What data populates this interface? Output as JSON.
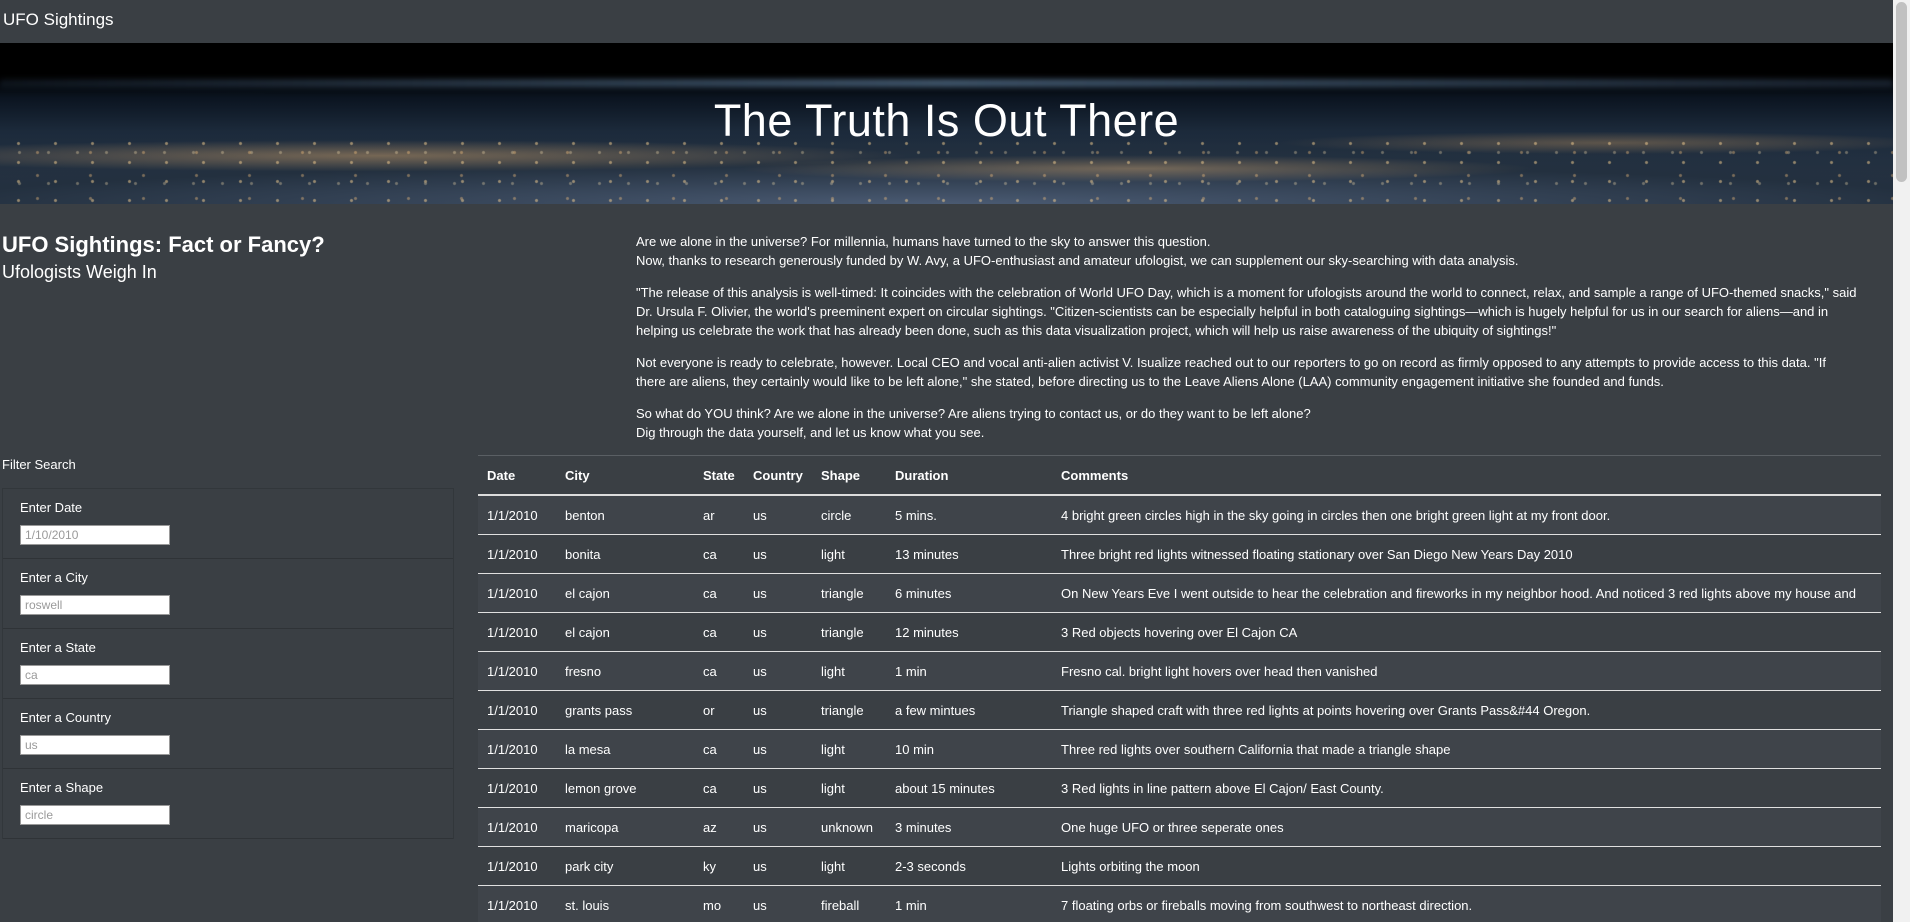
{
  "navbar": {
    "brand": "UFO Sightings"
  },
  "hero": {
    "title": "The Truth Is Out There"
  },
  "article": {
    "headline": "UFO Sightings: Fact or Fancy?",
    "subheadline": "Ufologists Weigh In",
    "p1_line1": "Are we alone in the universe? For millennia, humans have turned to the sky to answer this question.",
    "p1_line2": "Now, thanks to research generously funded by W. Avy, a UFO-enthusiast and amateur ufologist, we can supplement our sky-searching with data analysis.",
    "p2": "\"The release of this analysis is well-timed: It coincides with the celebration of World UFO Day, which is a moment for ufologists around the world to connect, relax, and sample a range of UFO-themed snacks,\" said Dr. Ursula F. Olivier, the world's preeminent expert on circular sightings. \"Citizen-scientists can be especially helpful in both cataloguing sightings—which is hugely helpful for us in our search for aliens—and in helping us celebrate the work that has already been done, such as this data visualization project, which will help us raise awareness of the ubiquity of sightings!\"",
    "p3": "Not everyone is ready to celebrate, however. Local CEO and vocal anti-alien activist V. Isualize reached out to our reporters to go on record as firmly opposed to any attempts to provide access to this data. \"If there are aliens, they certainly would like to be left alone,\" she stated, before directing us to the Leave Aliens Alone (LAA) community engagement initiative she founded and funds.",
    "p4_line1": "So what do YOU think? Are we alone in the universe? Are aliens trying to contact us, or do they want to be left alone?",
    "p4_line2": "Dig through the data yourself, and let us know what you see."
  },
  "filters": {
    "title": "Filter Search",
    "date": {
      "label": "Enter Date",
      "placeholder": "1/10/2010"
    },
    "city": {
      "label": "Enter a City",
      "placeholder": "roswell"
    },
    "state": {
      "label": "Enter a State",
      "placeholder": "ca"
    },
    "country": {
      "label": "Enter a Country",
      "placeholder": "us"
    },
    "shape": {
      "label": "Enter a Shape",
      "placeholder": "circle"
    }
  },
  "table": {
    "headers": [
      "Date",
      "City",
      "State",
      "Country",
      "Shape",
      "Duration",
      "Comments"
    ],
    "rows": [
      [
        "1/1/2010",
        "benton",
        "ar",
        "us",
        "circle",
        "5 mins.",
        "4 bright green circles high in the sky going in circles then one bright green light at my front door."
      ],
      [
        "1/1/2010",
        "bonita",
        "ca",
        "us",
        "light",
        "13 minutes",
        "Three bright red lights witnessed floating stationary over San Diego New Years Day 2010"
      ],
      [
        "1/1/2010",
        "el cajon",
        "ca",
        "us",
        "triangle",
        "6 minutes",
        "On New Years Eve I went outside to hear the celebration and fireworks in my neighbor hood. And noticed 3 red lights above my house and"
      ],
      [
        "1/1/2010",
        "el cajon",
        "ca",
        "us",
        "triangle",
        "12 minutes",
        "3 Red objects hovering over El Cajon CA"
      ],
      [
        "1/1/2010",
        "fresno",
        "ca",
        "us",
        "light",
        "1 min",
        "Fresno cal. bright light hovers over head then vanished"
      ],
      [
        "1/1/2010",
        "grants pass",
        "or",
        "us",
        "triangle",
        "a few mintues",
        "Triangle shaped craft with three red lights at points hovering over Grants Pass&#44 Oregon."
      ],
      [
        "1/1/2010",
        "la mesa",
        "ca",
        "us",
        "light",
        "10 min",
        "Three red lights over southern California that made a triangle shape"
      ],
      [
        "1/1/2010",
        "lemon grove",
        "ca",
        "us",
        "light",
        "about 15 minutes",
        "3 Red lights in line pattern above El Cajon/ East County."
      ],
      [
        "1/1/2010",
        "maricopa",
        "az",
        "us",
        "unknown",
        "3 minutes",
        "One huge UFO or three seperate ones"
      ],
      [
        "1/1/2010",
        "park city",
        "ky",
        "us",
        "light",
        "2-3 seconds",
        "Lights orbiting the moon"
      ],
      [
        "1/1/2010",
        "st. louis",
        "mo",
        "us",
        "fireball",
        "1 min",
        "7 floating orbs or fireballs moving from southwest to northeast direction."
      ]
    ]
  }
}
